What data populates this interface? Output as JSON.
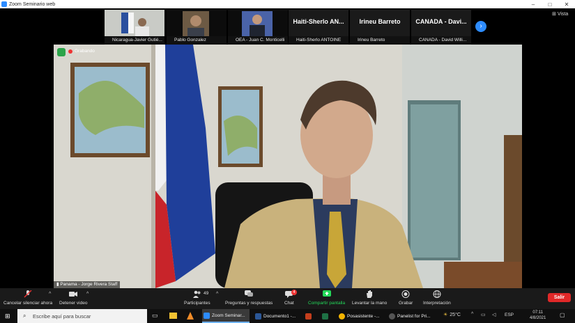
{
  "window": {
    "title": "Zoom Seminario web",
    "controls": [
      "–",
      "□",
      "✕"
    ]
  },
  "gallery": {
    "tiles": [
      {
        "name": "Nicaragua-Javier Gutié...",
        "big": ""
      },
      {
        "name": "Pablo Gonzalez",
        "big": ""
      },
      {
        "name": "OEA - Juan C. Monticelli",
        "big": ""
      },
      {
        "name": "Haiti-Sherlo ANTOINE",
        "big": "Haiti-Sherlo  AN..."
      },
      {
        "name": "Irineu Barreto",
        "big": "Irineu Barreto"
      },
      {
        "name": "CANADA - David Willi...",
        "big": "CANADA  -  Davi..."
      }
    ],
    "view_label": "Vista",
    "next_arrow": "›"
  },
  "main": {
    "recording_label": "Grabando",
    "speaker_name": "Panama - Jorge Rivera Staff"
  },
  "toolbar": {
    "unmute_label": "Cancelar silenciar ahora",
    "stop_video_label": "Detener video",
    "participants_label": "Participantes",
    "participants_count": "49",
    "qa_label": "Preguntas y respuestas",
    "chat_label": "Chat",
    "chat_badge": "4",
    "share_label": "Compartir pantalla",
    "raise_hand_label": "Levantar la mano",
    "record_label": "Grabar",
    "interpretation_label": "Interpretación",
    "leave_label": "Salir"
  },
  "taskbar": {
    "search_placeholder": "Escribe aquí para buscar",
    "apps": [
      {
        "label": "Zoom Seminar...",
        "color": "#2d8cff"
      },
      {
        "label": "Documento1 -...",
        "color": "#2b5797"
      },
      {
        "label": "",
        "color": "#c43e1c"
      },
      {
        "label": "",
        "color": "#1e7145"
      },
      {
        "label": "Posasistente -...",
        "color": "#f4b400"
      },
      {
        "label": "Panelist for Pri...",
        "color": "#555555"
      }
    ],
    "weather": "25°C",
    "language": "ESP",
    "time": "07:11",
    "date": "4/8/2021"
  },
  "colors": {
    "zoom_blue": "#2d8cff",
    "leave_red": "#e02828",
    "share_green": "#23d959",
    "toolbar_bg": "#1a1a1a"
  }
}
